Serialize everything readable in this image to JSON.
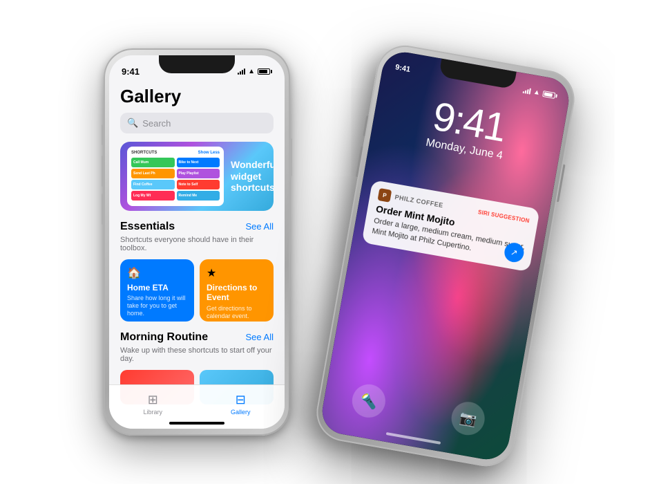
{
  "left_phone": {
    "status_bar": {
      "time": "9:41",
      "signal": "●●●●",
      "wifi": "WiFi",
      "battery": "100%"
    },
    "screen": {
      "title": "Gallery",
      "search_placeholder": "Search",
      "hero": {
        "shortcuts_header": "SHORTCUTS",
        "shortcuts_link": "Show Less",
        "text_line1": "Wonderful",
        "text_line2": "widget",
        "text_line3": "shortcuts",
        "items": [
          {
            "label": "Call Mum",
            "color": "#34c759"
          },
          {
            "label": "Bike to Next Event",
            "color": "#007aff"
          },
          {
            "label": "Send Last Photo",
            "color": "#ff9500"
          },
          {
            "label": "Play Playlist",
            "color": "#af52de"
          },
          {
            "label": "Find Coffee Shops",
            "color": "#5ac8fa"
          },
          {
            "label": "Note to Self",
            "color": "#ff3b30"
          },
          {
            "label": "Log My Weight",
            "color": "#ff2d55"
          },
          {
            "label": "Remind Me Later",
            "color": "#32ade6"
          }
        ]
      },
      "essentials": {
        "title": "Essentials",
        "see_all": "See All",
        "description": "Shortcuts everyone should have in their toolbox.",
        "cards": [
          {
            "title": "Home ETA",
            "desc": "Share how long it will take for you to get home.",
            "color": "#007aff",
            "icon": "🏠"
          },
          {
            "title": "Directions to Event",
            "desc": "Get directions to calendar event.",
            "color": "#ff9500",
            "icon": "★"
          }
        ]
      },
      "morning_routine": {
        "title": "Morning Routine",
        "see_all": "See All",
        "description": "Wake up with these shortcuts to start off your day."
      }
    },
    "tab_bar": {
      "tabs": [
        {
          "label": "Library",
          "icon": "⊞",
          "active": false
        },
        {
          "label": "Gallery",
          "icon": "⊟",
          "active": true
        }
      ]
    }
  },
  "right_phone": {
    "status_bar": {
      "time": "9:41"
    },
    "lock_screen": {
      "time": "9:41",
      "date": "Monday, June 4",
      "notification": {
        "app_name": "PHILZ COFFEE",
        "badge": "SIRI SUGGESTION",
        "title": "Order Mint Mojito",
        "body": "Order a large, medium cream, medium sugar, Mint Mojito at Philz Cupertino.",
        "action_icon": "↗"
      },
      "bottom_icons": [
        {
          "icon": "🔦",
          "name": "Flashlight"
        },
        {
          "icon": "📷",
          "name": "Camera"
        }
      ]
    }
  }
}
